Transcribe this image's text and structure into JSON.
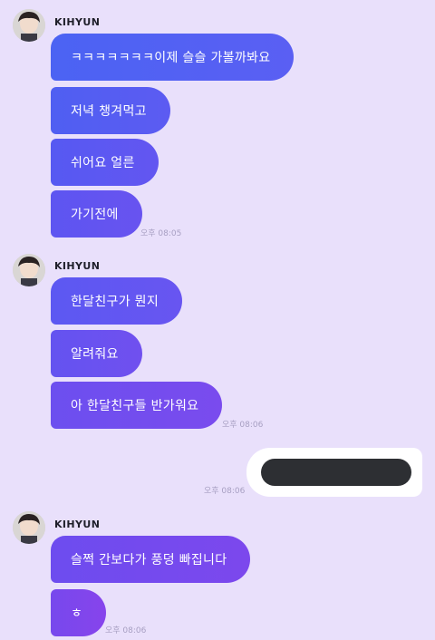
{
  "colors": {
    "background": "#e9e0fb",
    "bubble_start": "#4b63f3",
    "bubble_end": "#8744ec",
    "my_bubble": "#ffffff",
    "redaction": "#2d2f33",
    "time_text": "#a79fc2"
  },
  "groups": [
    {
      "sender": "KIHYUN",
      "messages": [
        "ㅋㅋㅋㅋㅋㅋㅋ이제 슬슬 가볼까봐요",
        "저녁 챙겨먹고",
        "쉬어요 얼른",
        "가기전에"
      ],
      "time": "오후 08:05"
    },
    {
      "sender": "KIHYUN",
      "messages": [
        "한달친구가 뭔지",
        "알려줘요",
        "아 한달친구들 반가워요"
      ],
      "time": "오후 08:06"
    },
    {
      "sender": "KIHYUN",
      "messages": [
        "슬쩍 간보다가 풍덩 빠집니다",
        "ㅎ"
      ],
      "time": "오후 08:06"
    }
  ],
  "my_message": {
    "redacted": true,
    "time": "오후 08:06"
  }
}
